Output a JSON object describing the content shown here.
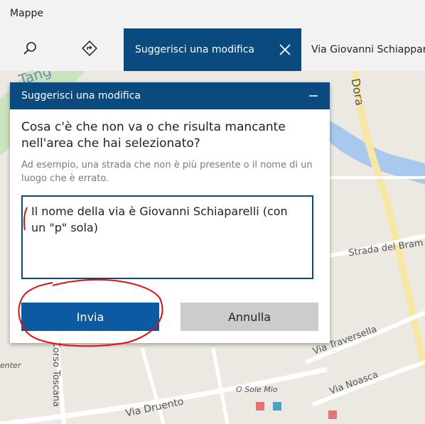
{
  "app": {
    "title": "Mappe"
  },
  "toolbar": {
    "search_icon": "search-icon",
    "directions_icon": "directions-icon",
    "active_tab_label": "Suggerisci una modifica",
    "next_tab_label": "Via Giovanni Schiapparelli"
  },
  "map": {
    "labels": {
      "top_left": "Tang",
      "top_right": "Dora",
      "right_mid": "Strada del Bram",
      "traversella": "Via Traversella",
      "noasca": "Via Noasca",
      "druento": "Via Druento",
      "o_sole_mio": "O Sole Mio",
      "toscana": "Corso Toscana",
      "enter": "enter"
    },
    "colors": {
      "land": "#ece9e2",
      "river": "#a9c8ee",
      "green": "#cbe4bd",
      "road": "#ffffff",
      "major_road": "#f7e7a4"
    }
  },
  "dialog": {
    "title": "Suggerisci una modifica",
    "question": "Cosa c'è che non va o che risulta mancante nell'area che hai selezionato?",
    "hint": "Ad esempio, una strada che non è più presente o il nome di un luogo che è errato.",
    "text_value": "Il nome della via è Giovanni Schiaparelli (con un \"p\" sola)",
    "send_label": "Invia",
    "cancel_label": "Annulla",
    "accent_color": "#0b4a7e"
  }
}
